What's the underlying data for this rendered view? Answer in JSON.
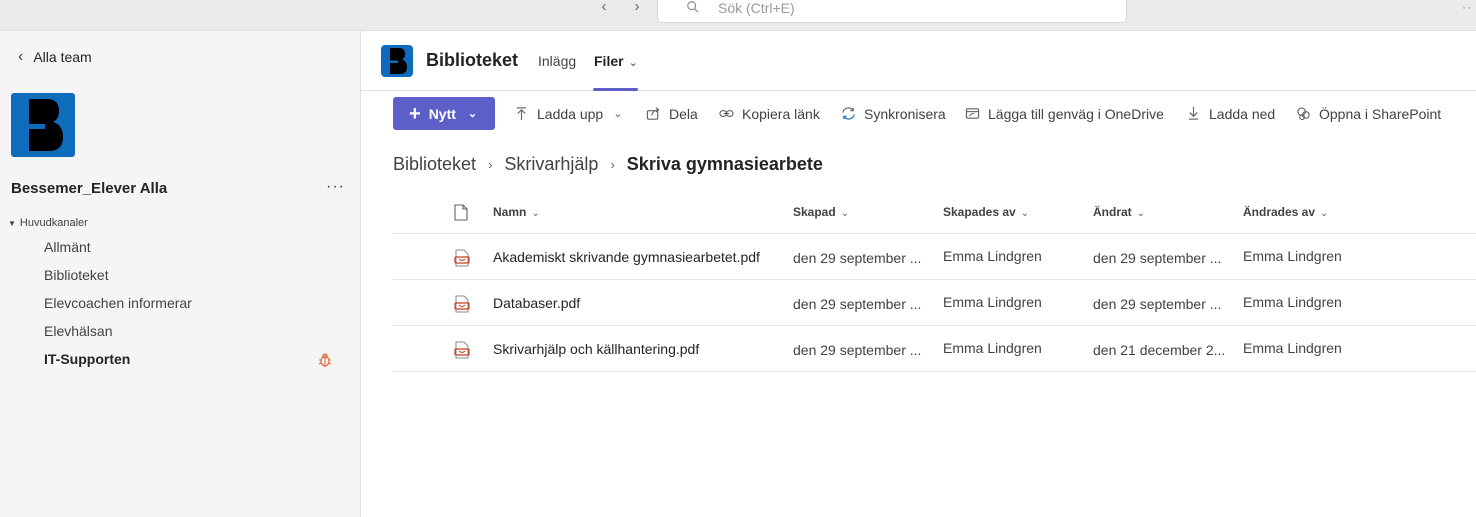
{
  "topbar": {
    "search_placeholder": "Sök (Ctrl+E)",
    "back_glyph": "‹",
    "forward_glyph": "›",
    "more_glyph": "··"
  },
  "sidebar": {
    "back_label": "Alla team",
    "team_name": "Bessemer_Elever Alla",
    "more_glyph": "···",
    "section_label": "Huvudkanaler",
    "channels": [
      {
        "label": "Allmänt"
      },
      {
        "label": "Biblioteket"
      },
      {
        "label": "Elevcoachen informerar"
      },
      {
        "label": "Elevhälsan"
      },
      {
        "label": "IT-Supporten",
        "bold": true,
        "badge_icon": "bug-icon"
      }
    ]
  },
  "header": {
    "title": "Biblioteket",
    "tabs": [
      {
        "label": "Inlägg"
      },
      {
        "label": "Filer",
        "active": true
      }
    ]
  },
  "toolbar": {
    "new_label": "Nytt",
    "items": [
      {
        "label": "Ladda upp",
        "icon": "upload-icon",
        "has_chevron": true
      },
      {
        "label": "Dela",
        "icon": "share-icon"
      },
      {
        "label": "Kopiera länk",
        "icon": "link-icon"
      },
      {
        "label": "Synkronisera",
        "icon": "sync-icon"
      },
      {
        "label": "Lägga till genväg i OneDrive",
        "icon": "onedrive-shortcut-icon"
      },
      {
        "label": "Ladda ned",
        "icon": "download-icon"
      },
      {
        "label": "Öppna i SharePoint",
        "icon": "sharepoint-icon"
      }
    ]
  },
  "breadcrumb": [
    "Biblioteket",
    "Skrivarhjälp",
    "Skriva gymnasiearbete"
  ],
  "table": {
    "columns": [
      "Namn",
      "Skapad",
      "Skapades av",
      "Ändrat",
      "Ändrades av"
    ],
    "rows": [
      {
        "name": "Akademiskt skrivande gymnasiearbetet.pdf",
        "created": "den 29 september ...",
        "created_by": "Emma Lindgren",
        "modified": "den 29 september ...",
        "modified_by": "Emma Lindgren"
      },
      {
        "name": "Databaser.pdf",
        "created": "den 29 september ...",
        "created_by": "Emma Lindgren",
        "modified": "den 29 september ...",
        "modified_by": "Emma Lindgren"
      },
      {
        "name": "Skrivarhjälp och källhantering.pdf",
        "created": "den 29 september ...",
        "created_by": "Emma Lindgren",
        "modified": "den 21 december 2...",
        "modified_by": "Emma Lindgren"
      }
    ]
  },
  "colors": {
    "accent": "#5b5fc7",
    "team_logo": "#0f6cbd",
    "pdf_red": "#c43e1c"
  }
}
